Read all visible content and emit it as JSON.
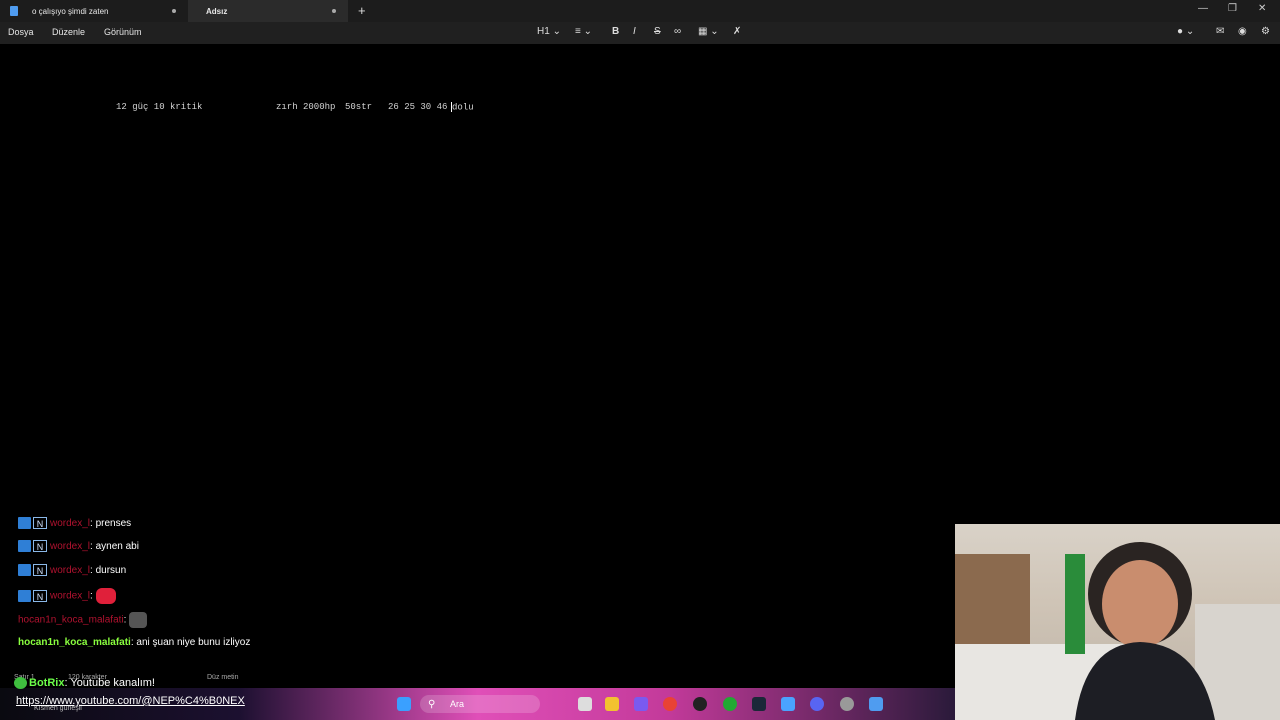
{
  "tabs": [
    {
      "label": "o çalışıyo şimdi zaten",
      "active": false
    },
    {
      "label": "Adsız",
      "active": true
    }
  ],
  "menu": [
    "Dosya",
    "Düzenle",
    "Görünüm"
  ],
  "toolbar": {
    "heading": "H1"
  },
  "editor": {
    "segments": [
      "12 güç 10 kritik",
      "zırh 2000hp",
      "50str",
      "26 25 30 46",
      "dolu"
    ]
  },
  "chat": [
    {
      "user": "wordex_l",
      "text": ": prenses"
    },
    {
      "user": "wordex_l",
      "text": ": aynen abi"
    },
    {
      "user": "wordex_l",
      "text": ": dursun"
    },
    {
      "user": "wordex_l",
      "text": ":"
    },
    {
      "user": "hocan1n_koca_malafati",
      "text": ":"
    },
    {
      "user": "hocan1n_koca_malafati",
      "text": ": ani şuan niye bunu izliyoz"
    }
  ],
  "status": {
    "left": "Satır 1",
    "chars": "120 karakter",
    "format": "Düz metin",
    "weather": "Kısmen güneşli"
  },
  "bot": {
    "name": "BotRix",
    "text": ": Youtube kanalım!"
  },
  "link": "https://www.youtube.com/@NEP%C4%B0NEX",
  "taskbar": {
    "search_placeholder": "Ara"
  },
  "colors": {
    "accent": "#4f9cf0",
    "green_user": "#8aff3f",
    "red_user": "#b0122f"
  }
}
